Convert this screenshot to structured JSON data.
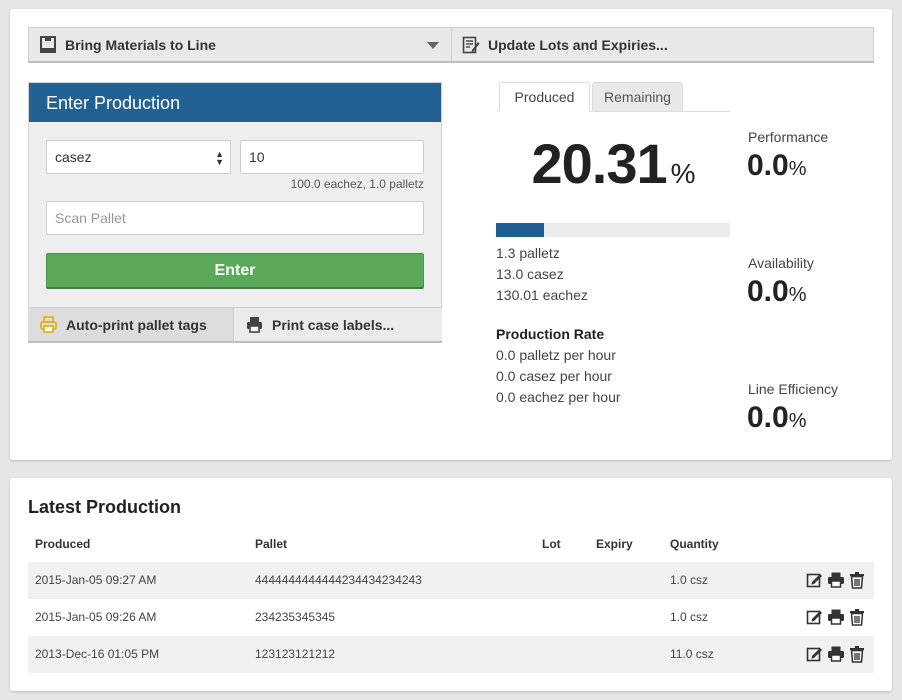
{
  "toolbar": {
    "bring_materials_label": "Bring Materials to Line",
    "update_lots_label": "Update Lots and Expiries..."
  },
  "enter_production": {
    "title": "Enter Production",
    "unit_selected": "casez",
    "quantity_value": "10",
    "conversion_text": "100.0 eachez, 1.0 palletz",
    "scan_placeholder": "Scan Pallet",
    "enter_label": "Enter",
    "autoprint_label": "Auto-print pallet tags",
    "print_case_label": "Print case labels..."
  },
  "progress": {
    "tabs": [
      {
        "label": "Produced",
        "active": true
      },
      {
        "label": "Remaining",
        "active": false
      }
    ],
    "percent_value": "20.31",
    "percent_sign": "%",
    "bar_fraction": 0.2031,
    "produced_lines": [
      "1.3 palletz",
      "13.0 casez",
      "130.01 eachez"
    ],
    "rate_title": "Production Rate",
    "rate_lines": [
      "0.0 palletz per hour",
      "0.0 casez per hour",
      "0.0 eachez per hour"
    ]
  },
  "metrics": [
    {
      "label": "Performance",
      "value": "0.0",
      "unit": "%"
    },
    {
      "label": "Availability",
      "value": "0.0",
      "unit": "%"
    },
    {
      "label": "Line Efficiency",
      "value": "0.0",
      "unit": "%"
    }
  ],
  "latest_production": {
    "title": "Latest Production",
    "columns": [
      "Produced",
      "Pallet",
      "Lot",
      "Expiry",
      "Quantity"
    ],
    "rows": [
      {
        "produced": "2015-Jan-05 09:27 AM",
        "pallet": "4444444444444234434234243",
        "lot": "",
        "expiry": "",
        "quantity": "1.0 csz"
      },
      {
        "produced": "2015-Jan-05 09:26 AM",
        "pallet": "234235345345",
        "lot": "",
        "expiry": "",
        "quantity": "1.0 csz"
      },
      {
        "produced": "2013-Dec-16 01:05 PM",
        "pallet": "123123121212",
        "lot": "",
        "expiry": "",
        "quantity": "11.0 csz"
      }
    ]
  },
  "colors": {
    "header_blue": "#236192",
    "enter_green": "#5aa95a",
    "bar_blue": "#1f5e93",
    "printer_yellow": "#e0b100"
  },
  "icons": {
    "bring_materials": "pallet-box-icon",
    "update_lots": "edit-document-icon",
    "autoprint": "printer-icon",
    "print_case": "printer-icon",
    "row_actions": [
      "edit-icon",
      "print-icon",
      "trash-icon"
    ]
  }
}
